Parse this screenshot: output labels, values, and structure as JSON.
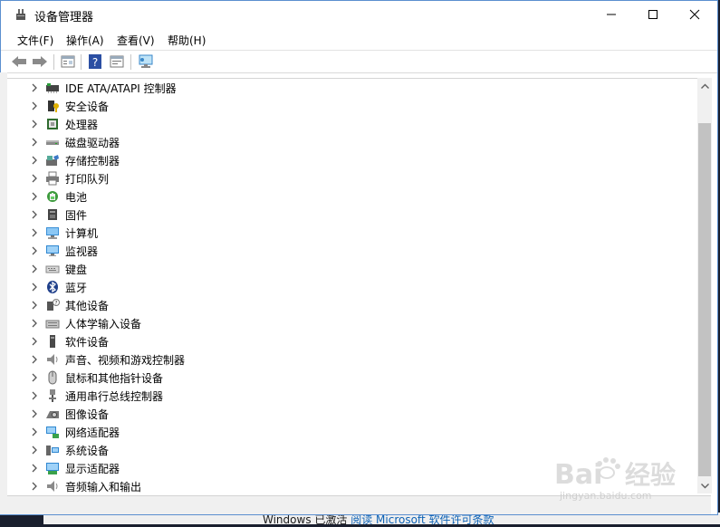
{
  "window": {
    "title": "设备管理器"
  },
  "menu": [
    "文件(F)",
    "操作(A)",
    "查看(V)",
    "帮助(H)"
  ],
  "toolbar": {
    "buttons": [
      "back-icon",
      "forward-icon",
      "properties-icon",
      "help-icon",
      "update-driver-icon",
      "scan-hardware-icon"
    ]
  },
  "devices": [
    {
      "label": "IDE ATA/ATAPI 控制器",
      "icon": "ide-controller-icon"
    },
    {
      "label": "安全设备",
      "icon": "security-device-icon"
    },
    {
      "label": "处理器",
      "icon": "processor-icon"
    },
    {
      "label": "磁盘驱动器",
      "icon": "disk-drive-icon"
    },
    {
      "label": "存储控制器",
      "icon": "storage-controller-icon"
    },
    {
      "label": "打印队列",
      "icon": "printer-icon"
    },
    {
      "label": "电池",
      "icon": "battery-icon"
    },
    {
      "label": "固件",
      "icon": "firmware-icon"
    },
    {
      "label": "计算机",
      "icon": "computer-icon"
    },
    {
      "label": "监视器",
      "icon": "monitor-icon"
    },
    {
      "label": "键盘",
      "icon": "keyboard-icon"
    },
    {
      "label": "蓝牙",
      "icon": "bluetooth-icon"
    },
    {
      "label": "其他设备",
      "icon": "other-devices-icon"
    },
    {
      "label": "人体学输入设备",
      "icon": "hid-icon"
    },
    {
      "label": "软件设备",
      "icon": "software-device-icon"
    },
    {
      "label": "声音、视频和游戏控制器",
      "icon": "sound-icon"
    },
    {
      "label": "鼠标和其他指针设备",
      "icon": "mouse-icon"
    },
    {
      "label": "通用串行总线控制器",
      "icon": "usb-icon"
    },
    {
      "label": "图像设备",
      "icon": "camera-icon"
    },
    {
      "label": "网络适配器",
      "icon": "network-adapter-icon"
    },
    {
      "label": "系统设备",
      "icon": "system-device-icon"
    },
    {
      "label": "显示适配器",
      "icon": "display-adapter-icon"
    },
    {
      "label": "音频输入和输出",
      "icon": "audio-io-icon"
    }
  ],
  "background": {
    "text_prefix": "Windows 已激活",
    "link": "阅读 Microsoft 软件许可条款"
  },
  "watermark": {
    "brand": "Bai",
    "brand2": "经验",
    "sub": "jingyan.baidu.com"
  }
}
